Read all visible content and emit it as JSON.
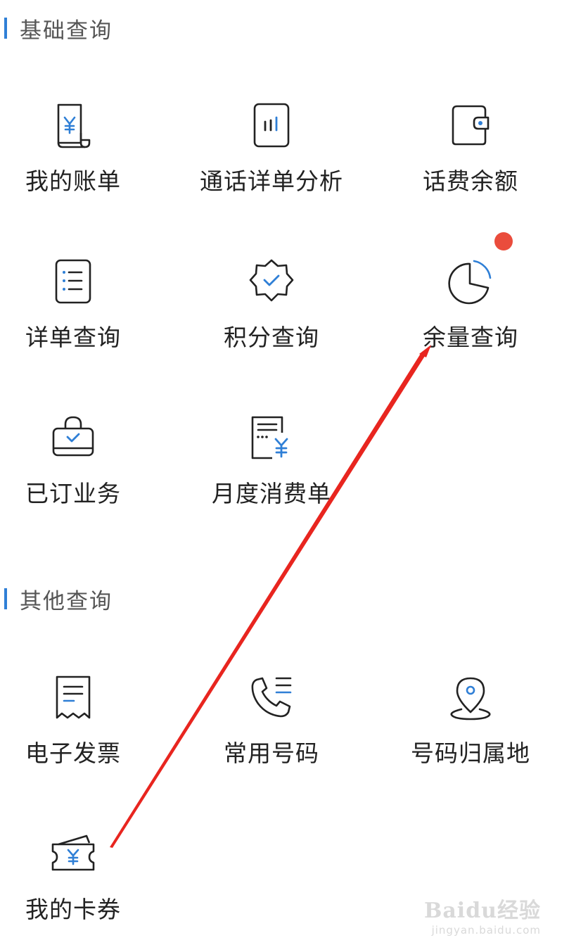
{
  "sections": [
    {
      "title": "基础查询",
      "items": [
        {
          "label": "我的账单",
          "icon": "bill-icon"
        },
        {
          "label": "通话详单分析",
          "icon": "call-analysis-icon"
        },
        {
          "label": "话费余额",
          "icon": "wallet-icon"
        },
        {
          "label": "详单查询",
          "icon": "list-document-icon"
        },
        {
          "label": "积分查询",
          "icon": "points-badge-icon"
        },
        {
          "label": "余量查询",
          "icon": "pie-chart-icon"
        },
        {
          "label": "已订业务",
          "icon": "subscribed-bag-icon"
        },
        {
          "label": "月度消费单",
          "icon": "monthly-statement-icon"
        }
      ]
    },
    {
      "title": "其他查询",
      "items": [
        {
          "label": "电子发票",
          "icon": "invoice-icon"
        },
        {
          "label": "常用号码",
          "icon": "phone-list-icon"
        },
        {
          "label": "号码归属地",
          "icon": "location-pin-icon"
        },
        {
          "label": "我的卡券",
          "icon": "coupon-ticket-icon"
        }
      ]
    }
  ],
  "colors": {
    "accent": "#2f7fd6",
    "icon_stroke": "#222222",
    "badge": "#ea4c3c",
    "annotation_arrow": "#e8251f"
  },
  "watermark": {
    "brand": "Baidu经验",
    "url": "jingyan.baidu.com"
  }
}
